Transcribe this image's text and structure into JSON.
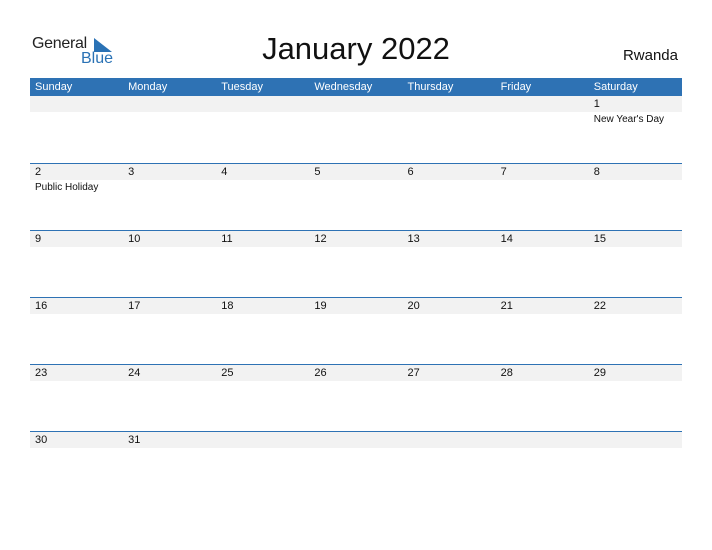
{
  "logo": {
    "general": "General",
    "blue": "Blue"
  },
  "title": "January 2022",
  "country": "Rwanda",
  "colors": {
    "accent": "#2e72b4",
    "strip": "#f2f2f2"
  },
  "weekdays": [
    "Sunday",
    "Monday",
    "Tuesday",
    "Wednesday",
    "Thursday",
    "Friday",
    "Saturday"
  ],
  "weeks": [
    [
      {
        "day": "",
        "event": ""
      },
      {
        "day": "",
        "event": ""
      },
      {
        "day": "",
        "event": ""
      },
      {
        "day": "",
        "event": ""
      },
      {
        "day": "",
        "event": ""
      },
      {
        "day": "",
        "event": ""
      },
      {
        "day": "1",
        "event": "New Year's Day"
      }
    ],
    [
      {
        "day": "2",
        "event": "Public Holiday"
      },
      {
        "day": "3",
        "event": ""
      },
      {
        "day": "4",
        "event": ""
      },
      {
        "day": "5",
        "event": ""
      },
      {
        "day": "6",
        "event": ""
      },
      {
        "day": "7",
        "event": ""
      },
      {
        "day": "8",
        "event": ""
      }
    ],
    [
      {
        "day": "9",
        "event": ""
      },
      {
        "day": "10",
        "event": ""
      },
      {
        "day": "11",
        "event": ""
      },
      {
        "day": "12",
        "event": ""
      },
      {
        "day": "13",
        "event": ""
      },
      {
        "day": "14",
        "event": ""
      },
      {
        "day": "15",
        "event": ""
      }
    ],
    [
      {
        "day": "16",
        "event": ""
      },
      {
        "day": "17",
        "event": ""
      },
      {
        "day": "18",
        "event": ""
      },
      {
        "day": "19",
        "event": ""
      },
      {
        "day": "20",
        "event": ""
      },
      {
        "day": "21",
        "event": ""
      },
      {
        "day": "22",
        "event": ""
      }
    ],
    [
      {
        "day": "23",
        "event": ""
      },
      {
        "day": "24",
        "event": ""
      },
      {
        "day": "25",
        "event": ""
      },
      {
        "day": "26",
        "event": ""
      },
      {
        "day": "27",
        "event": ""
      },
      {
        "day": "28",
        "event": ""
      },
      {
        "day": "29",
        "event": ""
      }
    ],
    [
      {
        "day": "30",
        "event": ""
      },
      {
        "day": "31",
        "event": ""
      },
      {
        "day": "",
        "event": ""
      },
      {
        "day": "",
        "event": ""
      },
      {
        "day": "",
        "event": ""
      },
      {
        "day": "",
        "event": ""
      },
      {
        "day": "",
        "event": ""
      }
    ]
  ]
}
